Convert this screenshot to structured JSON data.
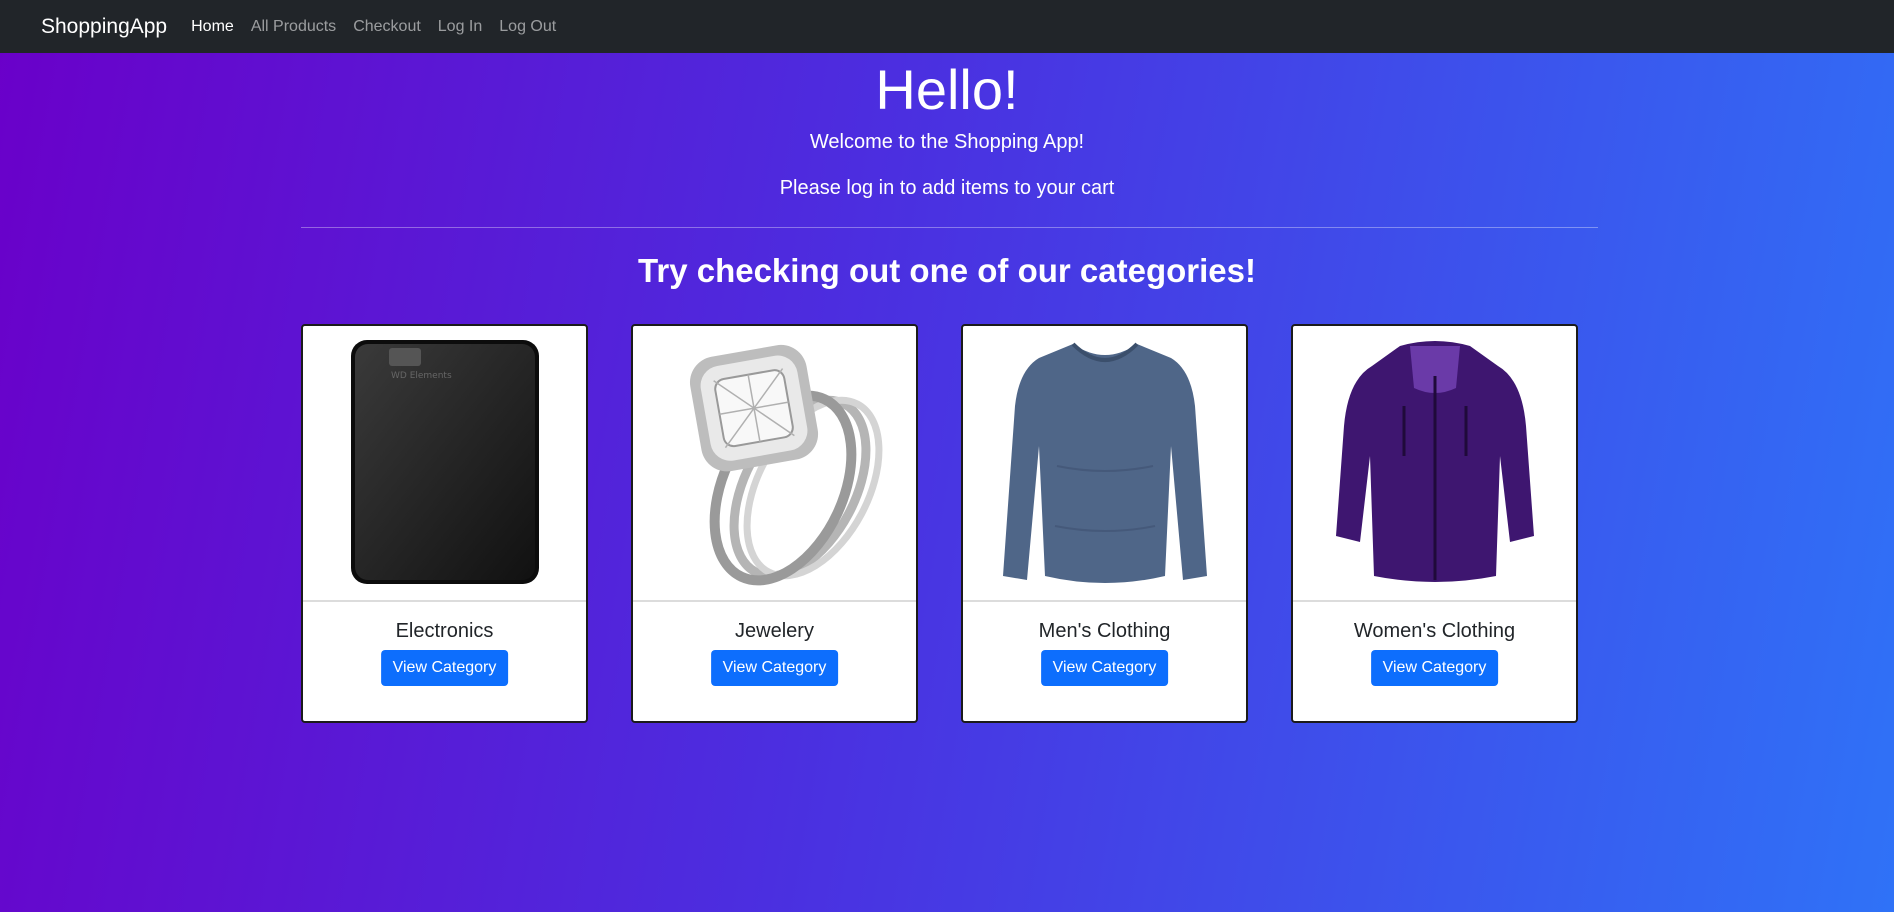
{
  "navbar": {
    "brand": "ShoppingApp",
    "links": [
      "Home",
      "All Products",
      "Checkout",
      "Log In",
      "Log Out"
    ],
    "active": "Home"
  },
  "hero": {
    "title": "Hello!",
    "welcome": "Welcome to the Shopping App!",
    "login_prompt": "Please log in to add items to your cart"
  },
  "categories_heading": "Try checking out one of our categories!",
  "categories": [
    {
      "name": "Electronics",
      "button": "View Category",
      "image": "external-hard-drive"
    },
    {
      "name": "Jewelery",
      "button": "View Category",
      "image": "diamond-ring-set"
    },
    {
      "name": "Men's Clothing",
      "button": "View Category",
      "image": "long-sleeve-shirt"
    },
    {
      "name": "Women's Clothing",
      "button": "View Category",
      "image": "purple-jacket"
    }
  ],
  "colors": {
    "navbar_bg": "#212529",
    "gradient_start": "#6a00c9",
    "gradient_end": "#2f72f7",
    "button_primary": "#0d6efd"
  }
}
